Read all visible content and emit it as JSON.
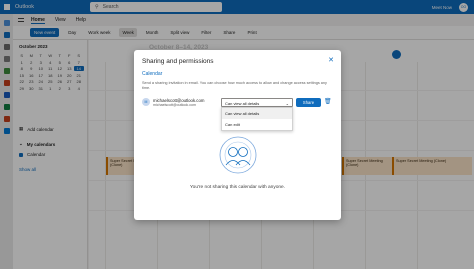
{
  "titlebar": {
    "app_name": "Outlook",
    "search_placeholder": "Search",
    "meet_now": "Meet Now",
    "avatar_initials": "OO"
  },
  "ribbon": {
    "tabs": [
      "Home",
      "View",
      "Help"
    ]
  },
  "toolbar": {
    "new_event": "New event",
    "day": "Day",
    "work_week": "Work week",
    "week": "Week",
    "month": "Month",
    "split_view": "Split view",
    "filter": "Filter",
    "share": "Share",
    "print": "Print"
  },
  "sidebar": {
    "month": "October 2023",
    "weekdays": [
      "S",
      "M",
      "T",
      "W",
      "T",
      "F",
      "S"
    ],
    "days": [
      "1",
      "2",
      "3",
      "4",
      "5",
      "6",
      "7",
      "8",
      "9",
      "10",
      "11",
      "12",
      "13",
      "14",
      "15",
      "16",
      "17",
      "18",
      "19",
      "20",
      "21",
      "22",
      "23",
      "24",
      "25",
      "26",
      "27",
      "28",
      "29",
      "30",
      "31",
      "1",
      "2",
      "3",
      "4"
    ],
    "add_calendar": "Add calendar",
    "my_calendars": "My calendars",
    "calendar": "Calendar",
    "show_all": "Show all"
  },
  "calendar": {
    "range": "October 8–14, 2023",
    "event_label": "Super Secret Meeting (Clone)"
  },
  "dialog": {
    "title": "Sharing and permissions",
    "section": "Calendar",
    "description": "Send a sharing invitation in email. You can choose how much access to allow and change access settings any time.",
    "person_initials": "M",
    "person_email": "michaelscott@outlook.com",
    "person_email_secondary": "michaelscott@outlook.com",
    "permission_value": "Can view all details",
    "permission_options": [
      "Can view all details",
      "Can edit"
    ],
    "share_label": "Share",
    "empty_message": "You're not sharing this calendar with anyone."
  },
  "colors": {
    "brand": "#0f6cbd",
    "event_bg": "#fbe3c8"
  },
  "icons": [
    "waffle-icon",
    "search-icon",
    "close-icon",
    "trash-icon",
    "chevron-down-icon",
    "people-illustration"
  ]
}
